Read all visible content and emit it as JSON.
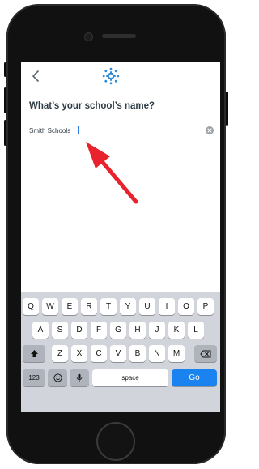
{
  "screen": {
    "title": "What’s your school’s name?",
    "search_field": {
      "value": "Smith Schools"
    }
  },
  "icons": {
    "back": "chevron-left-icon",
    "logo": "canvas-logo-icon",
    "clear": "clear-x-icon",
    "arrow": "red-annotation-arrow"
  },
  "keyboard": {
    "row1": [
      "Q",
      "W",
      "E",
      "R",
      "T",
      "Y",
      "U",
      "I",
      "O",
      "P"
    ],
    "row2": [
      "A",
      "S",
      "D",
      "F",
      "G",
      "H",
      "J",
      "K",
      "L"
    ],
    "row3": [
      "Z",
      "X",
      "C",
      "V",
      "B",
      "N",
      "M"
    ],
    "numbers_label": "123",
    "space_label": "space",
    "go_label": "Go"
  },
  "colors": {
    "accent": "#1a83f0",
    "brand": "#2d8ad6",
    "annotation": "#e8232d",
    "text": "#2d3b45"
  }
}
